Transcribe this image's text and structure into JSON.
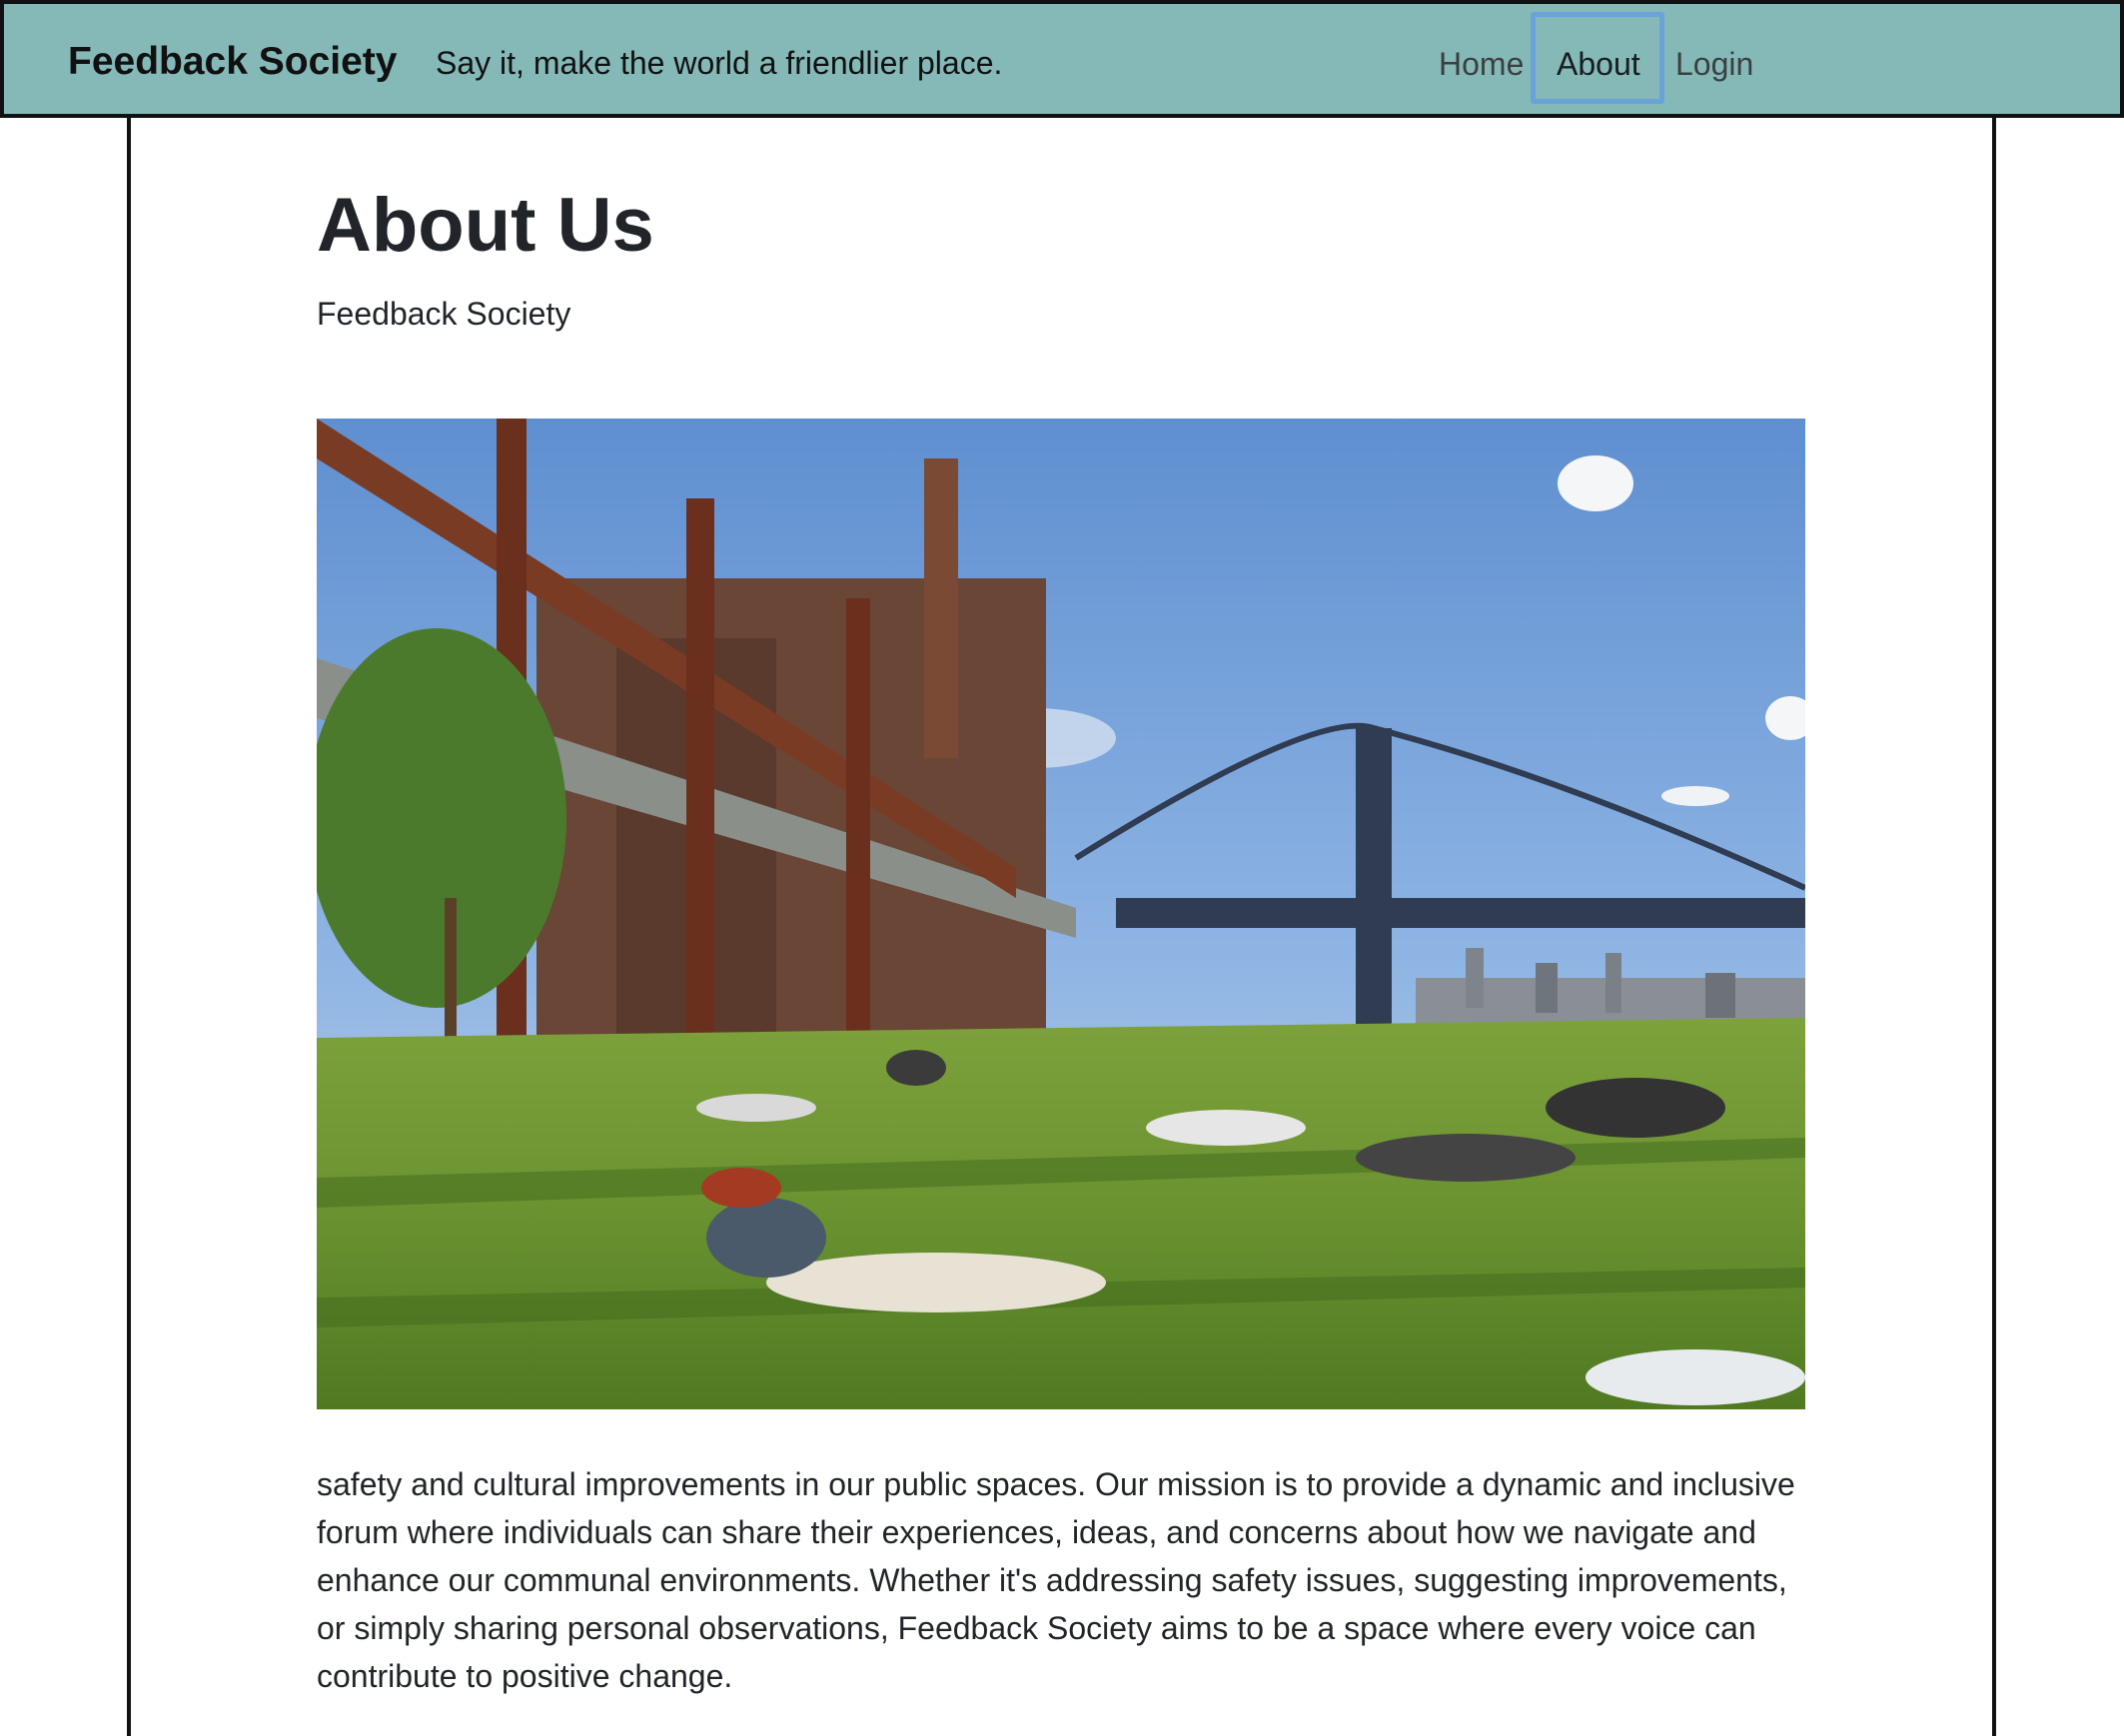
{
  "navbar": {
    "brand": "Feedback Society",
    "tagline": "Say it, make the world a friendlier place.",
    "links": [
      "Home",
      "About",
      "Login"
    ],
    "active_link": "About",
    "background": "#84b9b8"
  },
  "main": {
    "title": "About Us",
    "subtitle": "Feedback Society",
    "image_icon": "park-photo",
    "body": "safety and cultural improvements in our public spaces. Our mission is to provide a dynamic and inclusive forum where individuals can share their experiences, ideas, and concerns about how we navigate and enhance our communal environments. Whether it's addressing safety issues, suggesting improvements, or simply sharing personal observations, Feedback Society aims to be a space where every voice can contribute to positive change."
  }
}
